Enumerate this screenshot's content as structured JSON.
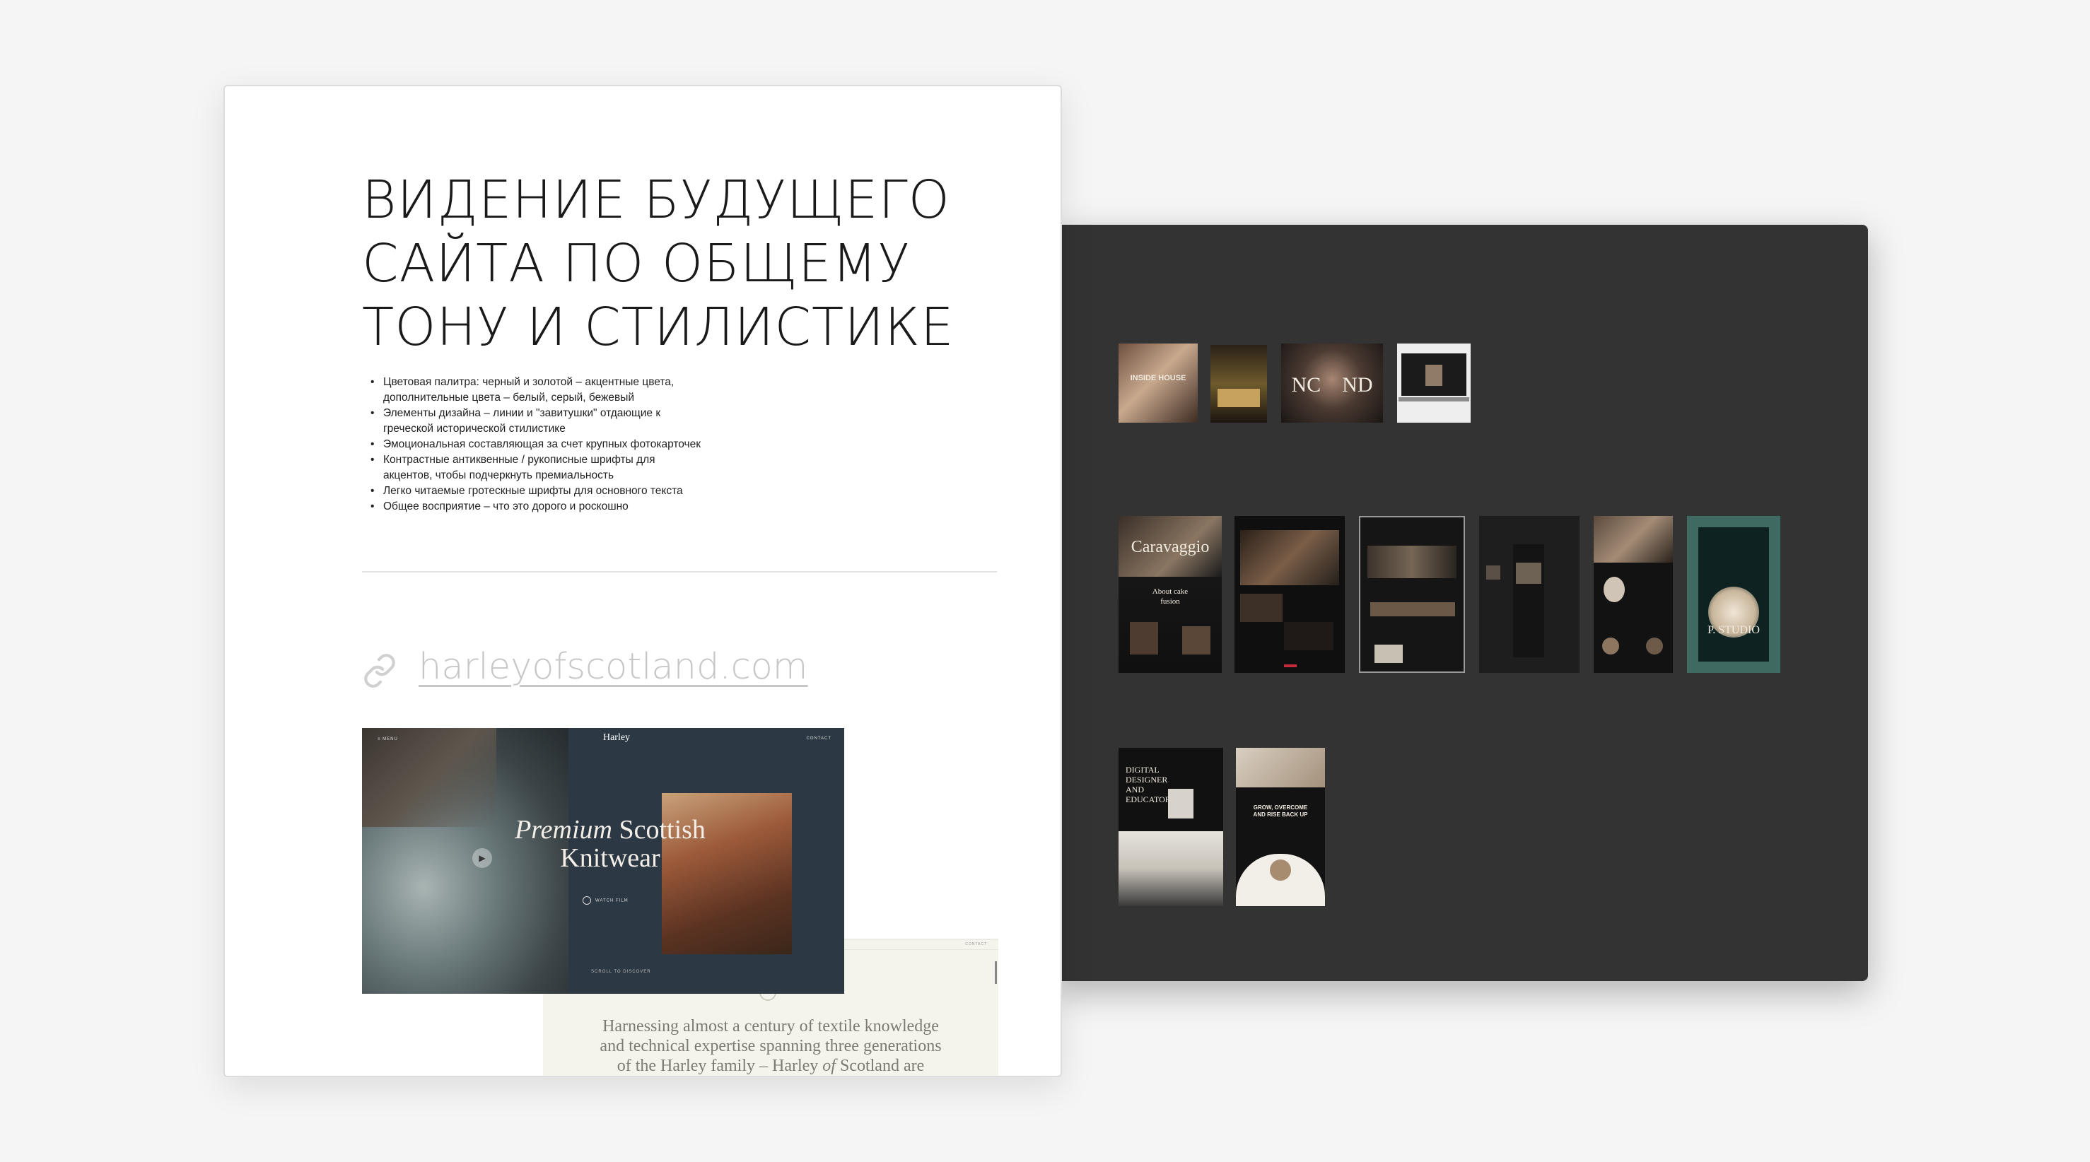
{
  "document": {
    "title_lines": [
      "ВИДЕНИЕ БУДУЩЕГО",
      "САЙТА ПО ОБЩЕМУ",
      "ТОНУ И СТИЛИСТИКЕ"
    ],
    "bullets": [
      "Цветовая палитра: черный и золотой – акцентные цвета,",
      "дополнительные цвета – белый, серый, бежевый",
      "Элементы дизайна – линии и \"завитушки\" отдающие к",
      "греческой исторической стилистике",
      "Эмоциональная составляющая за счет крупных фотокарточек",
      "Контрастные антиквенные / рукописные шрифты для",
      "акцентов, чтобы подчеркнуть премиальность",
      "Легко читаемые гротескные шрифты для основного текста",
      "Общее восприятие – что это дорого и роскошно"
    ],
    "link_text": "harleyofscotland.com",
    "link_icon": "link-icon"
  },
  "hero": {
    "brand": "Harley",
    "nav_left": "≡ MENU",
    "nav_right": "CONTACT",
    "headline_italic": "Premium",
    "headline_word": "Scottish",
    "headline_line2": "Knitwear",
    "watch_label": "WATCH FILM",
    "scroll_label": "SCROLL TO DISCOVER"
  },
  "cream": {
    "menu_label": "CONTACT",
    "text_line1": "Harnessing almost a century of textile knowledge",
    "text_line2": "and technical expertise spanning three generations",
    "text_line3_a": "of the Harley family – Harley",
    "text_line3_italic": "of",
    "text_line3_b": "Scotland are"
  },
  "moodboard": {
    "thumb_texts": {
      "inside_house": "INSIDE HOUSE",
      "nc_nd": "NC    ND",
      "caravaggio": "Caravaggio",
      "about": "About cake fusion",
      "digital": "DIGITAL DESIGNER AND EDUCATOR",
      "studio": "P. STUDIO",
      "grow": "GROW, OVERCOME AND RISE BACK UP"
    }
  },
  "colors": {
    "page_bg": "#f5f5f5",
    "board_bg": "#333333",
    "card_bg": "#ffffff",
    "link_color": "#c7c7c7",
    "hero_navy": "#2c3945",
    "cream_bg": "#f4f3ec"
  }
}
